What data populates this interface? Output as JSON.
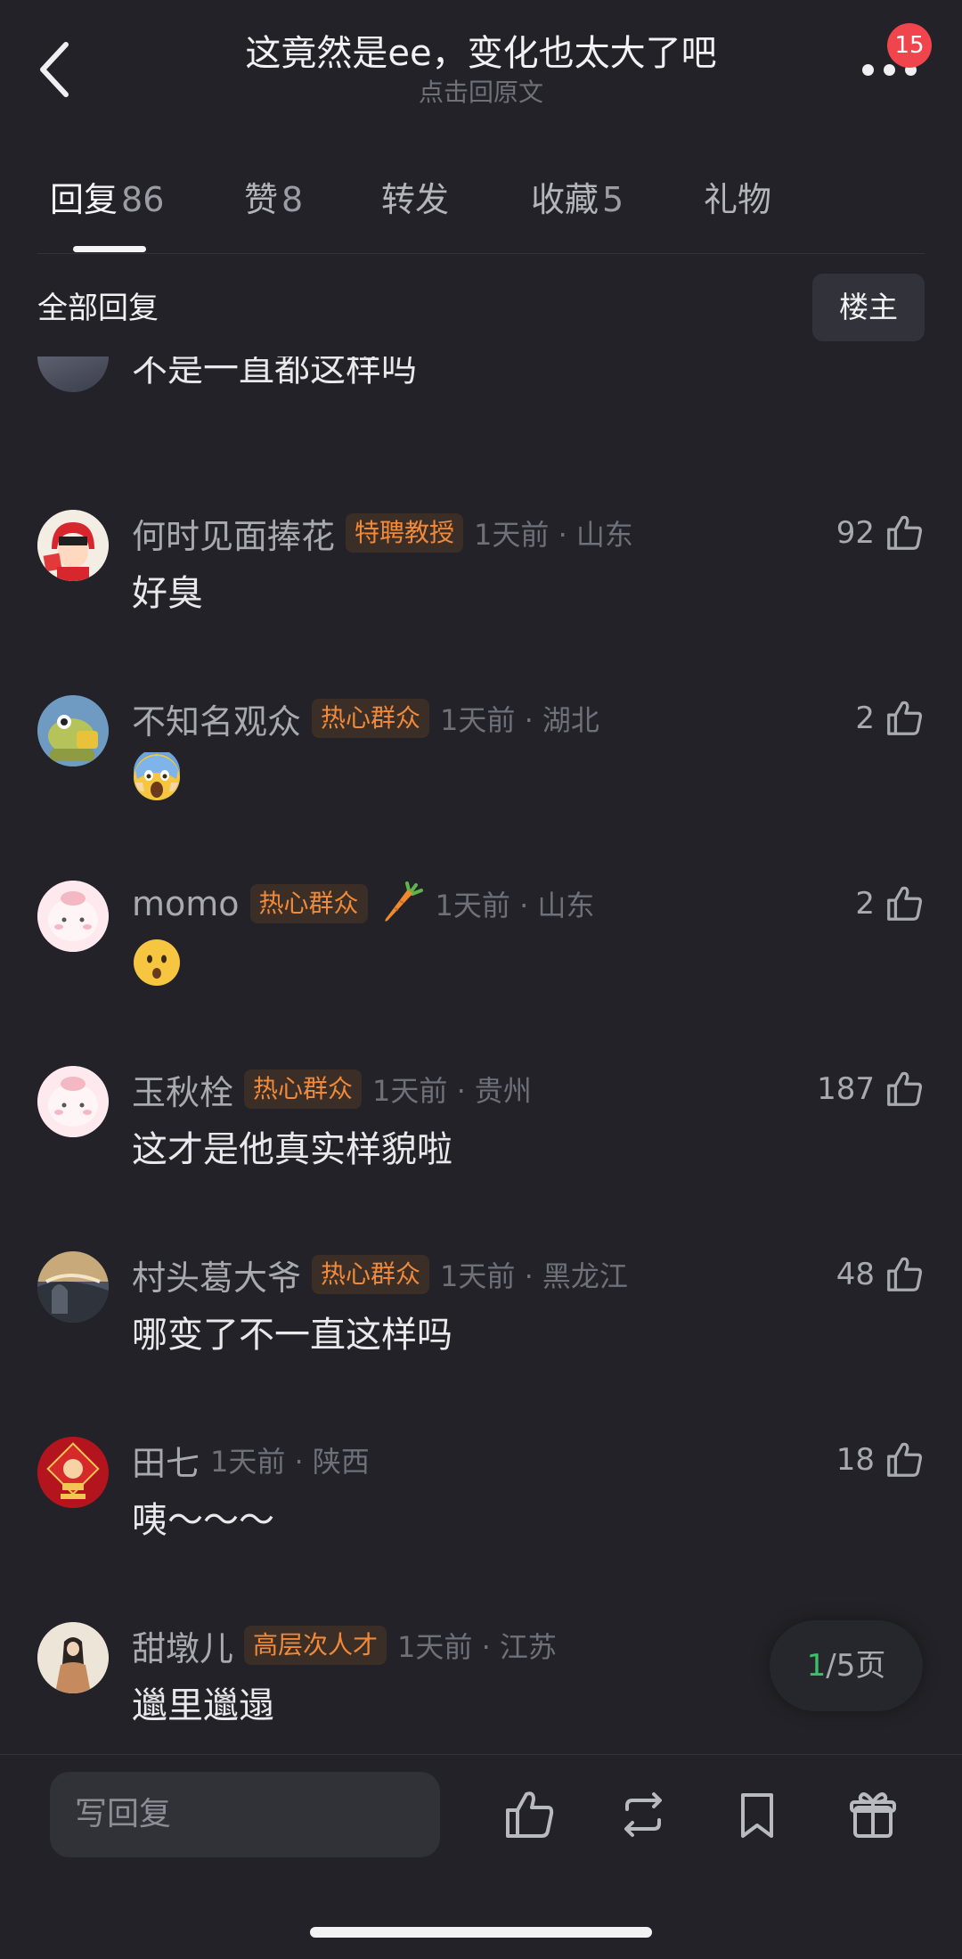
{
  "header": {
    "title": "这竟然是ee，变化也太大了吧",
    "subtitle": "点击回原文",
    "notification_count": "15"
  },
  "tabs": [
    {
      "label": "回复",
      "count": "86",
      "active": true
    },
    {
      "label": "赞",
      "count": "8"
    },
    {
      "label": "转发",
      "count": ""
    },
    {
      "label": "收藏",
      "count": "5"
    },
    {
      "label": "礼物",
      "count": ""
    }
  ],
  "filter": {
    "label": "全部回复",
    "op_button": "楼主"
  },
  "partial_comment": {
    "text": "不是一直都这样吗"
  },
  "comments": [
    {
      "username": "何时见面捧花",
      "tag": "特聘教授",
      "time": "1天前 · 山东",
      "likes": "92",
      "text": "好臭"
    },
    {
      "username": "不知名观众",
      "tag": "热心群众",
      "time": "1天前 · 湖北",
      "likes": "2",
      "emoji": "screaming-face"
    },
    {
      "username": "momo",
      "tag": "热心群众",
      "time": "1天前 · 山东",
      "likes": "2",
      "emoji": "hushed-face",
      "extra_icon": "carrot"
    },
    {
      "username": "玉秋栓",
      "tag": "热心群众",
      "time": "1天前 · 贵州",
      "likes": "187",
      "text": "这才是他真实样貌啦"
    },
    {
      "username": "村头葛大爷",
      "tag": "热心群众",
      "time": "1天前 · 黑龙江",
      "likes": "48",
      "text": "哪变了不一直这样吗"
    },
    {
      "username": "田七",
      "tag": "",
      "time": "1天前 · 陕西",
      "likes": "18",
      "text": "咦～～～"
    },
    {
      "username": "甜墩儿",
      "tag": "高层次人才",
      "time": "1天前 · 江苏",
      "likes": "",
      "text": "邋里邋遢"
    }
  ],
  "pagination": {
    "current": "1",
    "total_text": "/5页"
  },
  "bottom_bar": {
    "reply_placeholder": "写回复",
    "actions": [
      "like-icon",
      "repost-icon",
      "bookmark-icon",
      "gift-icon"
    ]
  },
  "colors": {
    "background": "#222228",
    "tag_text": "#f08a3a",
    "tag_bg": "#3b2e27",
    "badge": "#f0454d",
    "page_current": "#3ec06b"
  }
}
